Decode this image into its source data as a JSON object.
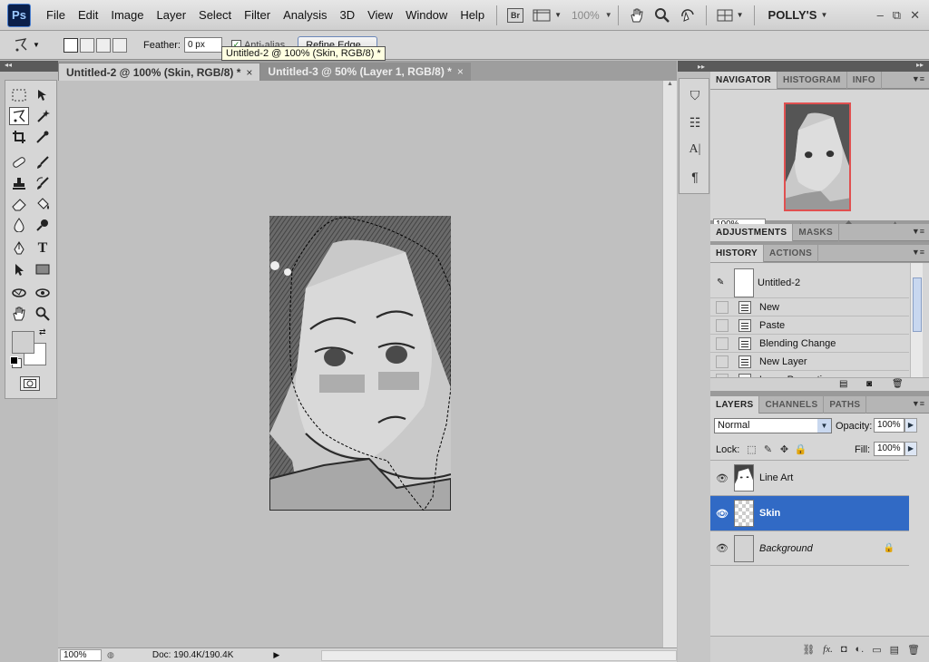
{
  "app": {
    "logo": "Ps",
    "workspace": "POLLY'S",
    "zoom_dropdown": "100%",
    "bridge_label": "Br"
  },
  "menu": [
    "File",
    "Edit",
    "Image",
    "Layer",
    "Select",
    "Filter",
    "Analysis",
    "3D",
    "View",
    "Window",
    "Help"
  ],
  "options": {
    "feather_label": "Feather:",
    "feather_value": "0 px",
    "antialias_label": "Anti-alias",
    "refine_edge": "Refine Edge...",
    "tooltip": "Untitled-2 @ 100% (Skin, RGB/8) *"
  },
  "documents": {
    "tabs": [
      {
        "label": "Untitled-2 @ 100% (Skin, RGB/8) *",
        "active": true
      },
      {
        "label": "Untitled-3 @ 50% (Layer 1, RGB/8) *",
        "active": false
      }
    ],
    "status_zoom": "100%",
    "status_doc": "Doc: 190.4K/190.4K"
  },
  "panels": {
    "navigator_tabs": [
      "NAVIGATOR",
      "HISTOGRAM",
      "INFO"
    ],
    "navigator_zoom": "100%",
    "adjustments_tabs": [
      "ADJUSTMENTS",
      "MASKS"
    ],
    "history_tabs": [
      "HISTORY",
      "ACTIONS"
    ],
    "history_snapshot": "Untitled-2",
    "history_items": [
      "New",
      "Paste",
      "Blending Change",
      "New Layer",
      "Layer Properties"
    ],
    "layers_tabs": [
      "LAYERS",
      "CHANNELS",
      "PATHS"
    ],
    "blend_mode": "Normal",
    "opacity_label": "Opacity:",
    "opacity_value": "100%",
    "lock_label": "Lock:",
    "fill_label": "Fill:",
    "fill_value": "100%",
    "layers": [
      {
        "name": "Line Art",
        "selected": false
      },
      {
        "name": "Skin",
        "selected": true
      },
      {
        "name": "Background",
        "selected": false,
        "locked": true
      }
    ]
  },
  "colors": {
    "selection": "#316ac5",
    "accent_border": "#e05050"
  }
}
